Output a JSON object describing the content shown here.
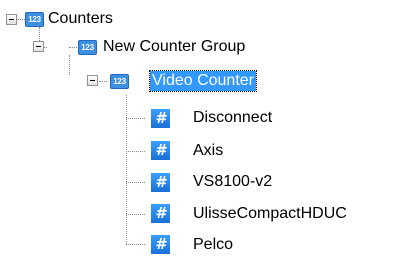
{
  "tree": {
    "root": {
      "label": "Counters",
      "icon": "123-counter-icon",
      "expanded": true,
      "children": [
        {
          "label": "New Counter Group",
          "icon": "123-counter-icon",
          "expanded": true,
          "children": [
            {
              "label": "Video Counter",
              "icon": "123-counter-icon",
              "expanded": true,
              "selected": true,
              "children": [
                {
                  "label": "Disconnect",
                  "icon": "hash-icon"
                },
                {
                  "label": "Axis",
                  "icon": "hash-icon"
                },
                {
                  "label": "VS8100-v2",
                  "icon": "hash-icon"
                },
                {
                  "label": "UlisseCompactHDUC",
                  "icon": "hash-icon"
                },
                {
                  "label": "Pelco",
                  "icon": "hash-icon"
                }
              ]
            }
          ]
        }
      ]
    },
    "icon_text": "123",
    "hash_glyph": "#",
    "colors": {
      "selection_background": "#3399ff",
      "selection_text": "#ffffff",
      "icon_blue": "#3d8fe0"
    }
  }
}
